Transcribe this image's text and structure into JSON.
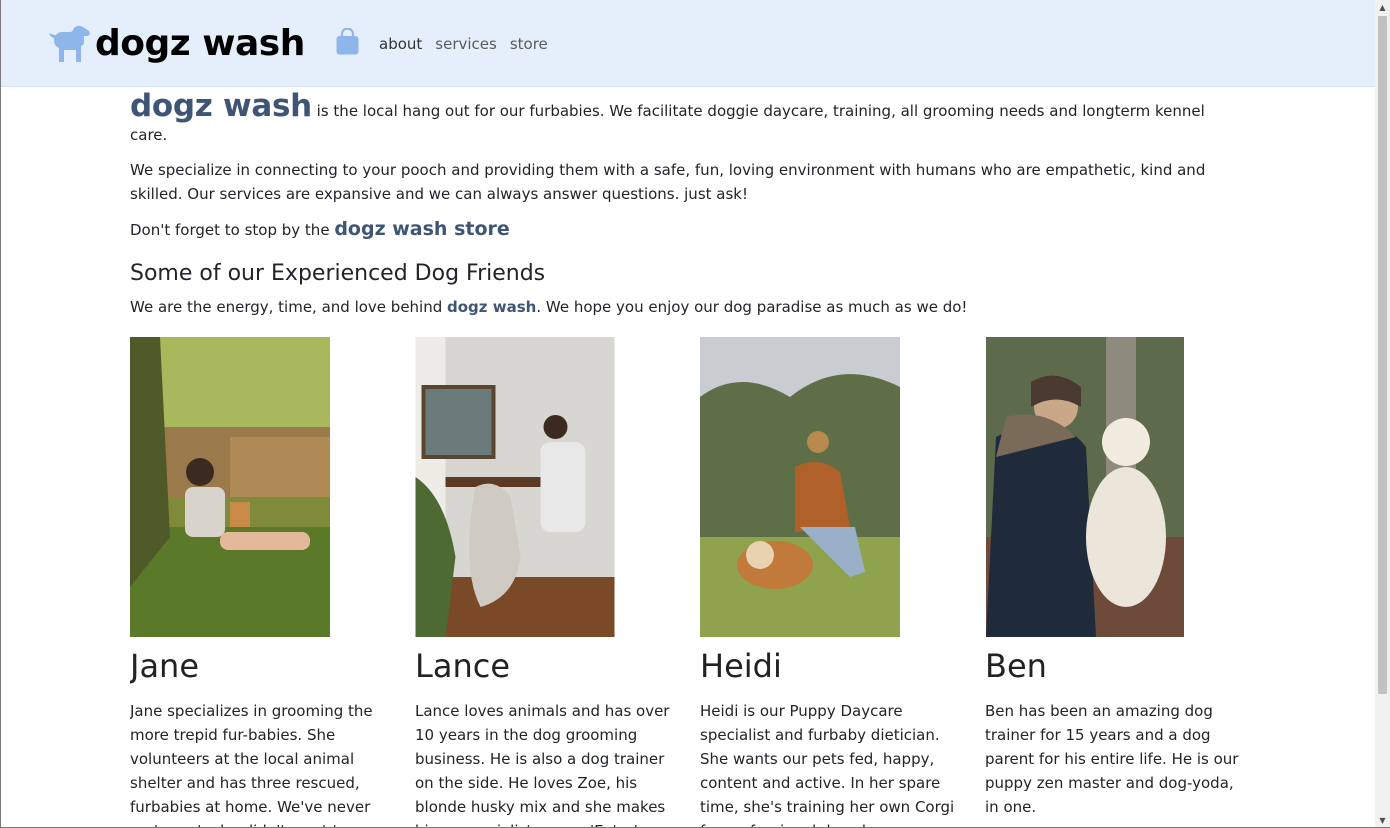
{
  "nav": {
    "brand": "dogz wash",
    "links": [
      "about",
      "services",
      "store"
    ]
  },
  "intro": {
    "brand": "dogz wash",
    "text": " is the local hang out for our furbabies. We facilitate doggie daycare, training, all grooming needs and longterm kennel care."
  },
  "specialize": "We specialize in connecting to your pooch and providing them with a safe, fun, loving environment with humans who are empathetic, kind and skilled. Our services are expansive and we can always answer questions. just ask!",
  "store": {
    "prefix": "Don't forget to stop by the ",
    "link": "dogz wash store"
  },
  "team": {
    "title": "Some of our Experienced Dog Friends",
    "sub_prefix": "We are the energy, time, and love behind ",
    "sub_brand": "dogz wash",
    "sub_suffix": ". We hope you enjoy our dog paradise as much as we do!",
    "members": [
      {
        "name": "Jane",
        "bio": "Jane specializes in grooming the more trepid fur-babies. She volunteers at the local animal shelter and has three rescued, furbabies at home. We've never met a pet who didn't want to snuggle with Jane."
      },
      {
        "name": "Lance",
        "bio": "Lance loves animals and has over 10 years in the dog grooming business. He is also a dog trainer on the side. He loves Zoe, his blonde husky mix and she makes him a specialist on our 'Extra' Service for hair removal."
      },
      {
        "name": "Heidi",
        "bio": "Heidi is our Puppy Daycare specialist and furbaby dietician. She wants our pets fed, happy, content and active. In her spare time, she's training her own Corgi for professional dog shows."
      },
      {
        "name": "Ben",
        "bio": "Ben has been an amazing dog trainer for 15 years and a dog parent for his entire life. He is our puppy zen master and dog-yoda, in one."
      }
    ]
  },
  "colors": {
    "navbar_bg": "#e5effb",
    "brand_accent": "#3e5575",
    "icon_blue": "#8fb6ea"
  },
  "icons": [
    "dog-logo-icon",
    "shopping-bag-icon"
  ]
}
